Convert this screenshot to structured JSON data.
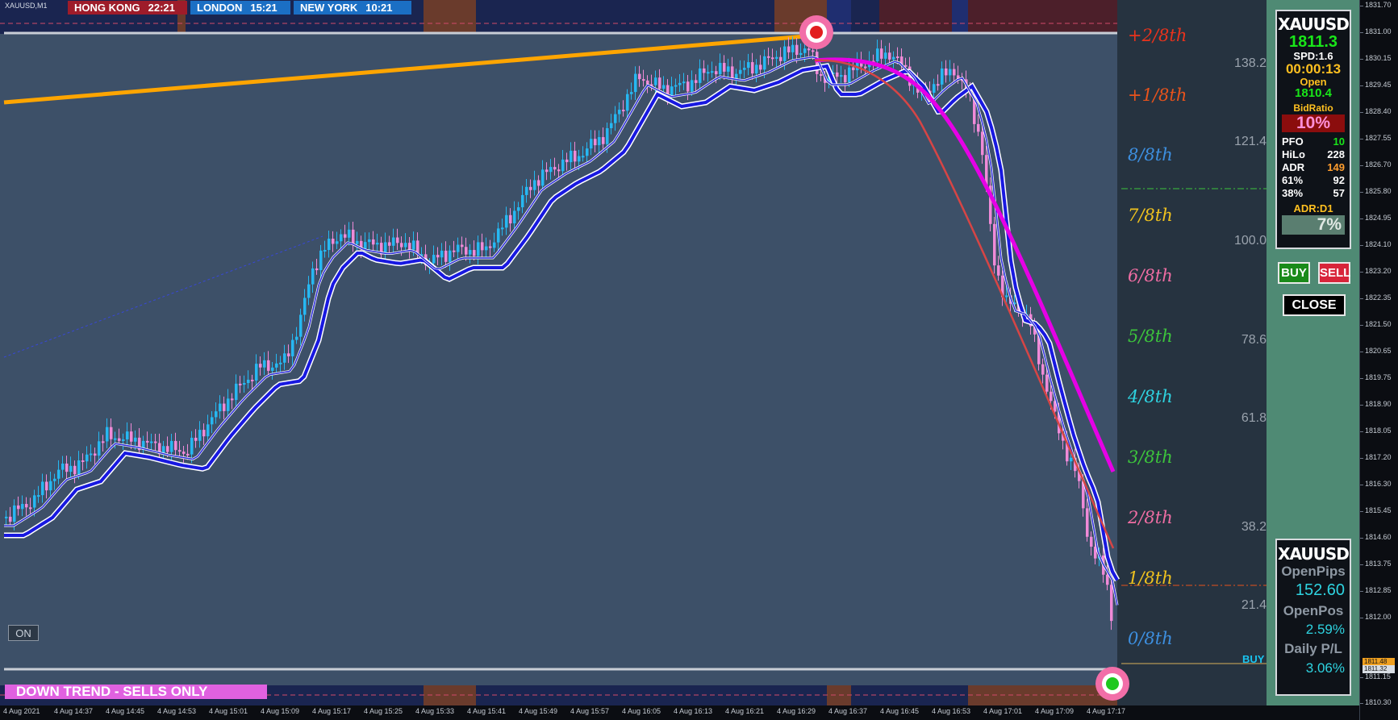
{
  "chart": {
    "symbol_label": "XAUUSD,M1",
    "sessions": [
      {
        "name": "HONG KONG",
        "time": "22:21",
        "color": "#9e1c2a"
      },
      {
        "name": "LONDON",
        "time": "15:21",
        "color": "#1b6fc4"
      },
      {
        "name": "NEW YORK",
        "time": "10:21",
        "color": "#1b6fc4"
      }
    ],
    "murrey_levels": [
      {
        "label": "+2/8th",
        "color": "#e8331c"
      },
      {
        "label": "+1/8th",
        "color": "#e8531c"
      },
      {
        "label": "8/8th",
        "color": "#3d8fe0"
      },
      {
        "label": "7/8th",
        "color": "#f0c21e"
      },
      {
        "label": "6/8th",
        "color": "#ef6da3"
      },
      {
        "label": "5/8th",
        "color": "#3cc43c"
      },
      {
        "label": "4/8th",
        "color": "#2ed3e0"
      },
      {
        "label": "3/8th",
        "color": "#3cc43c"
      },
      {
        "label": "2/8th",
        "color": "#ef6da3"
      },
      {
        "label": "1/8th",
        "color": "#f0c21e"
      },
      {
        "label": "0/8th",
        "color": "#3d8fe0"
      }
    ],
    "fib_levels": [
      "138.2",
      "121.4",
      "100.0",
      "78.6",
      "61.8",
      "38.2",
      "21.4"
    ],
    "buy_label": "BUY",
    "on_button": "ON",
    "trend_banner": "DOWN TREND - SELLS ONLY"
  },
  "time_axis": [
    "4 Aug 2021",
    "4 Aug 14:37",
    "4 Aug 14:45",
    "4 Aug 14:53",
    "4 Aug 15:01",
    "4 Aug 15:09",
    "4 Aug 15:17",
    "4 Aug 15:25",
    "4 Aug 15:33",
    "4 Aug 15:41",
    "4 Aug 15:49",
    "4 Aug 15:57",
    "4 Aug 16:05",
    "4 Aug 16:13",
    "4 Aug 16:21",
    "4 Aug 16:29",
    "4 Aug 16:37",
    "4 Aug 16:45",
    "4 Aug 16:53",
    "4 Aug 17:01",
    "4 Aug 17:09",
    "4 Aug 17:17"
  ],
  "price_axis": {
    "ticks": [
      "1831.70",
      "1831.00",
      "1830.15",
      "1829.45",
      "1828.40",
      "1827.55",
      "1826.70",
      "1825.80",
      "1824.95",
      "1824.10",
      "1823.20",
      "1822.35",
      "1821.50",
      "1820.65",
      "1819.75",
      "1818.90",
      "1818.05",
      "1817.20",
      "1816.30",
      "1815.45",
      "1814.60",
      "1813.75",
      "1812.85",
      "1812.00",
      "1811.15",
      "1810.30"
    ],
    "current_tags": [
      "1811.48",
      "1811.32"
    ]
  },
  "dashboard": {
    "panel1": {
      "symbol": "XAUUSD",
      "price": "1811.3",
      "spread": "SPD:1.6",
      "timer": "00:00:13",
      "open_label": "Open",
      "open_value": "1810.4",
      "bidratio_label": "BidRatio",
      "bidratio_value": "10%",
      "rows": [
        {
          "label": "PFO",
          "value": "10",
          "color": "#19e619"
        },
        {
          "label": "HiLo",
          "value": "228",
          "color": "#ffffff"
        },
        {
          "label": "ADR",
          "value": "149",
          "color": "#ff9d2e"
        },
        {
          "label": "61%",
          "value": "92",
          "color": "#ffffff"
        },
        {
          "label": "38%",
          "value": "57",
          "color": "#ffffff"
        }
      ],
      "adr_label": "ADR:D1",
      "adr_value": "7%"
    },
    "buttons": {
      "buy": "BUY",
      "sell": "SELL",
      "close": "CLOSE"
    },
    "panel2": {
      "symbol": "XAUUSD",
      "openpips_label": "OpenPips",
      "openpips_value": "152.60",
      "openpos_label": "OpenPos",
      "openpos_value": "2.59%",
      "dailypl_label": "Daily P/L",
      "dailypl_value": "3.06%"
    },
    "colors": {
      "bg": "#4f8a74",
      "buy": "#1a8a1a",
      "sell": "#d8253a"
    }
  }
}
